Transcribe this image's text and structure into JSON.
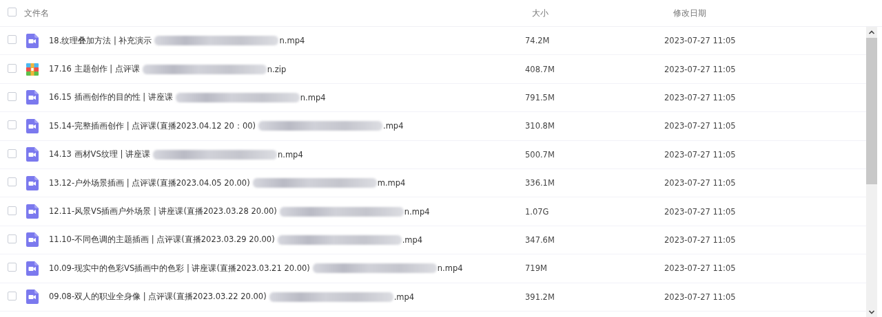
{
  "table": {
    "columns": [
      "文件名",
      "大小",
      "修改日期"
    ],
    "header_checkbox": {
      "checked": false
    },
    "rows": [
      {
        "kind": "video",
        "name": "18.纹理叠加方法 | 补充演示",
        "name_end": "n.mp4",
        "size": "74.2M",
        "modified": "2023-07-27 11:05",
        "checked": false
      },
      {
        "kind": "zip",
        "name": "17.16 主题创作 | 点评课",
        "name_end": "n.zip",
        "size": "408.7M",
        "modified": "2023-07-27 11:05",
        "checked": false
      },
      {
        "kind": "video",
        "name": "16.15 插画创作的目的性 | 讲座课",
        "name_end": "n.mp4",
        "size": "791.5M",
        "modified": "2023-07-27 11:05",
        "checked": false
      },
      {
        "kind": "video",
        "name": "15.14-完整插画创作 | 点评课(直播2023.04.12 20：00)",
        "name_end": ".mp4",
        "size": "310.8M",
        "modified": "2023-07-27 11:05",
        "checked": false
      },
      {
        "kind": "video",
        "name": "14.13 画材VS纹理 | 讲座课",
        "name_end": "n.mp4",
        "size": "500.7M",
        "modified": "2023-07-27 11:05",
        "checked": false
      },
      {
        "kind": "video",
        "name": "13.12-户外场景插画 | 点评课(直播2023.04.05 20.00)",
        "name_end": "m.mp4",
        "size": "336.1M",
        "modified": "2023-07-27 11:05",
        "checked": false
      },
      {
        "kind": "video",
        "name": "12.11-风景VS插画户外场景 | 讲座课(直播2023.03.28 20.00)",
        "name_end": "n.mp4",
        "size": "1.07G",
        "modified": "2023-07-27 11:05",
        "checked": false
      },
      {
        "kind": "video",
        "name": "11.10-不同色调的主题插画 | 点评课(直播2023.03.29 20.00)",
        "name_end": ".mp4",
        "size": "347.6M",
        "modified": "2023-07-27 11:05",
        "checked": false
      },
      {
        "kind": "video",
        "name": "10.09-现实中的色彩VS插画中的色彩 | 讲座课(直播2023.03.21 20.00)",
        "name_end": "n.mp4",
        "size": "719M",
        "modified": "2023-07-27 11:05",
        "checked": false
      },
      {
        "kind": "video",
        "name": "09.08-双人的职业全身像 | 点评课(直播2023.03.22 20.00)",
        "name_end": ".mp4",
        "size": "391.2M",
        "modified": "2023-07-27 11:05",
        "checked": false
      }
    ]
  }
}
